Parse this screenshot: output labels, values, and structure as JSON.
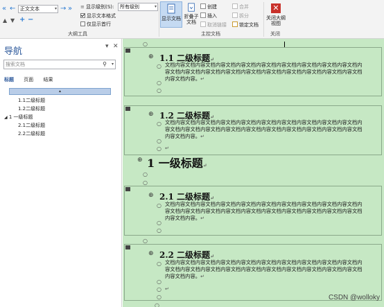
{
  "ribbon": {
    "style_combo": "正文文本",
    "show_level_label": "显示级别(S):",
    "show_level_value": "所有级别",
    "show_text_format": "显示文本格式",
    "show_first_line": "仅显示首行",
    "outline_tools_label": "大纲工具",
    "show_document": "显示文档",
    "collapse_subdoc": "折叠子文档",
    "create": "创建",
    "insert": "插入",
    "unlink": "取消链接",
    "merge": "合并",
    "split": "拆分",
    "lock_doc": "锁定文档",
    "master_doc_label": "主控文档",
    "close_outline": "关闭大纲视图",
    "close_label": "关闭"
  },
  "nav": {
    "title": "导航",
    "search_placeholder": "搜索文档",
    "tabs": [
      "标题",
      "页面",
      "结果"
    ],
    "items": [
      {
        "label": "1.1二级标题"
      },
      {
        "label": "1.2二级标题"
      },
      {
        "label": "1 一级标题"
      },
      {
        "label": "2.1二级标题"
      },
      {
        "label": "2.2二级标题"
      }
    ]
  },
  "doc": {
    "sections": [
      {
        "heading": "1.1 二级标题",
        "body": "文档内容文档内容文档内容文档内容文档内容文档内容文档内容文档内容文档内容文档内容文档内容文档内容文档内容文档内容文档内容文档内容文档内容文档内容文档内容文档内容文档内容。"
      },
      {
        "heading": "1.2 二级标题",
        "body": "文档内容文档内容文档内容文档内容文档内容文档内容文档内容文档内容文档内容文档内容文档内容文档内容文档内容文档内容文档内容文档内容文档内容文档内容文档内容文档内容文档内容。"
      },
      {
        "heading": "2.1 二级标题",
        "body": "文档内容文档内容文档内容文档内容文档内容文档内容文档内容文档内容文档内容文档内容文档内容文档内容文档内容文档内容文档内容文档内容文档内容文档内容文档内容文档内容文档内容。"
      },
      {
        "heading": "2.2 二级标题",
        "body": "文档内容文档内容文档内容文档内容文档内容文档内容文档内容文档内容文档内容文档内容文档内容文档内容文档内容文档内容文档内容文档内容文档内容文档内容文档内容文档内容文档内容。"
      }
    ],
    "h1": "1  一级标题"
  },
  "watermark": "CSDN @wolloky"
}
